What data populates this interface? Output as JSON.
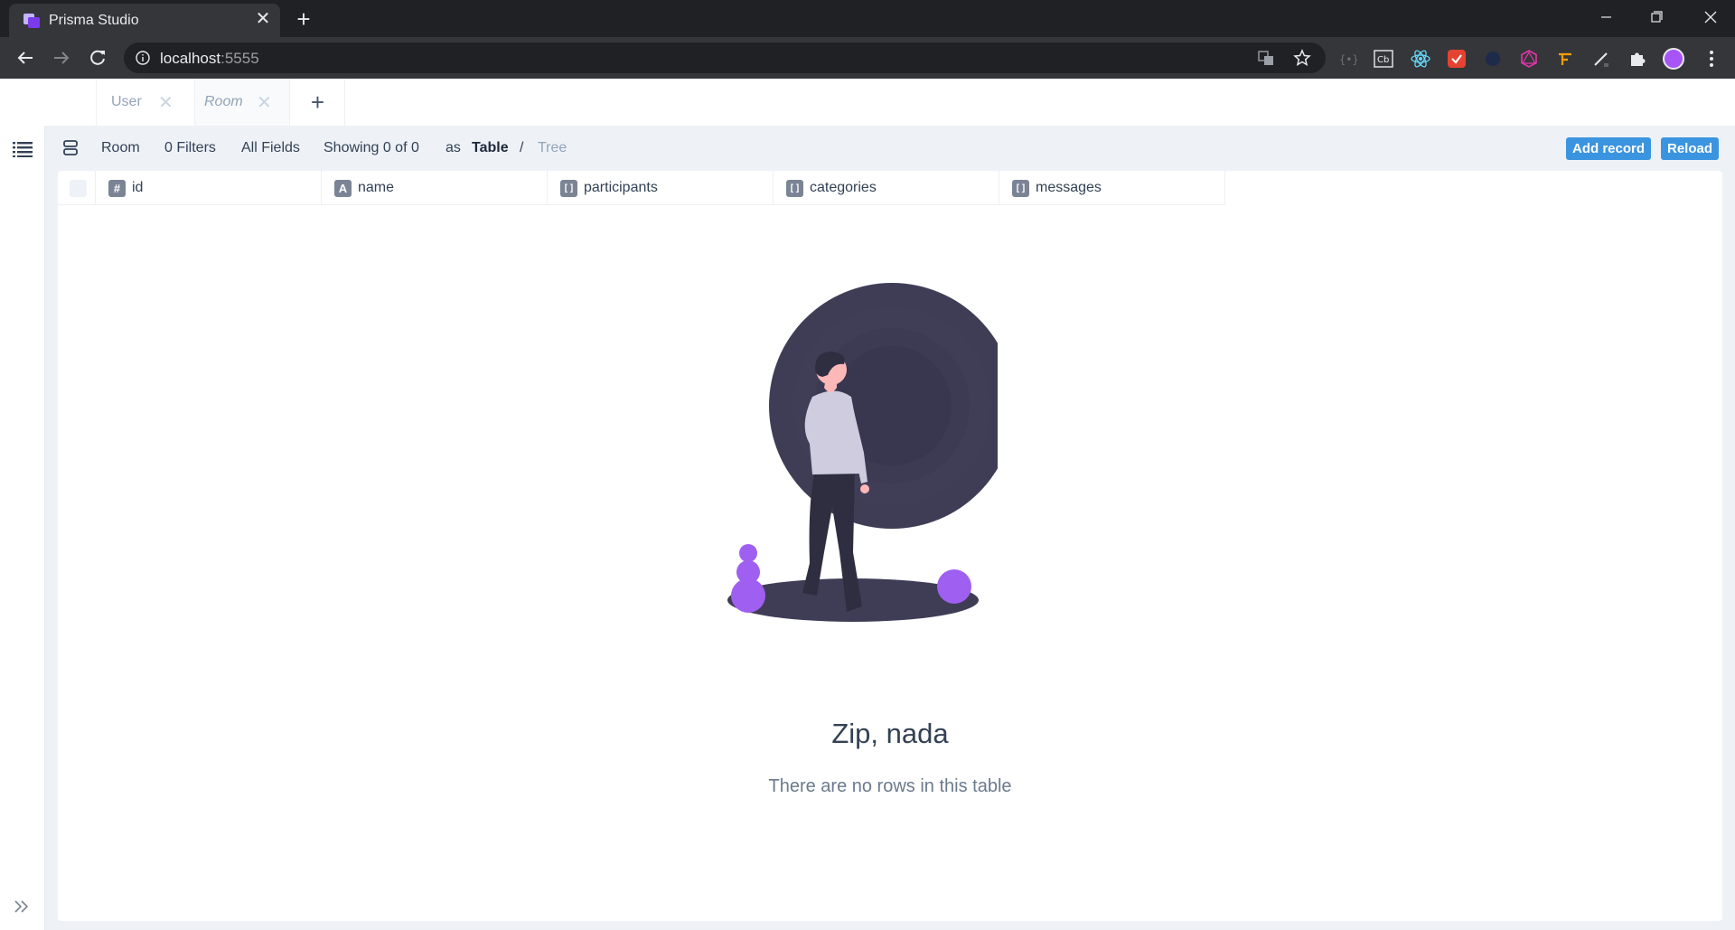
{
  "browser": {
    "tab_title": "Prisma Studio",
    "tab_close": "✕",
    "new_tab": "+",
    "url_host": "localhost",
    "url_port": ":5555"
  },
  "studio": {
    "tabs": [
      {
        "label": "User",
        "close": "✕"
      },
      {
        "label": "Room",
        "close": "✕"
      }
    ],
    "add_tab": "+",
    "action_bar": {
      "model": "Room",
      "filters": "0 Filters",
      "fields": "All Fields",
      "showing": "Showing 0 of 0",
      "as_label": "as",
      "view_table": "Table",
      "separator": "/",
      "view_tree": "Tree",
      "add_record": "Add record",
      "reload": "Reload"
    },
    "columns": [
      {
        "badge": "#",
        "label": "id"
      },
      {
        "badge": "A",
        "label": "name"
      },
      {
        "badge": "[ ]",
        "label": "participants"
      },
      {
        "badge": "[ ]",
        "label": "categories"
      },
      {
        "badge": "[ ]",
        "label": "messages"
      }
    ],
    "empty_state": {
      "title": "Zip, nada",
      "subtitle": "There are no rows in this table"
    }
  },
  "colors": {
    "accent_button": "#3b94e0",
    "illustration_dark": "#3f3d56",
    "illustration_purple": "#9f5ff0"
  }
}
